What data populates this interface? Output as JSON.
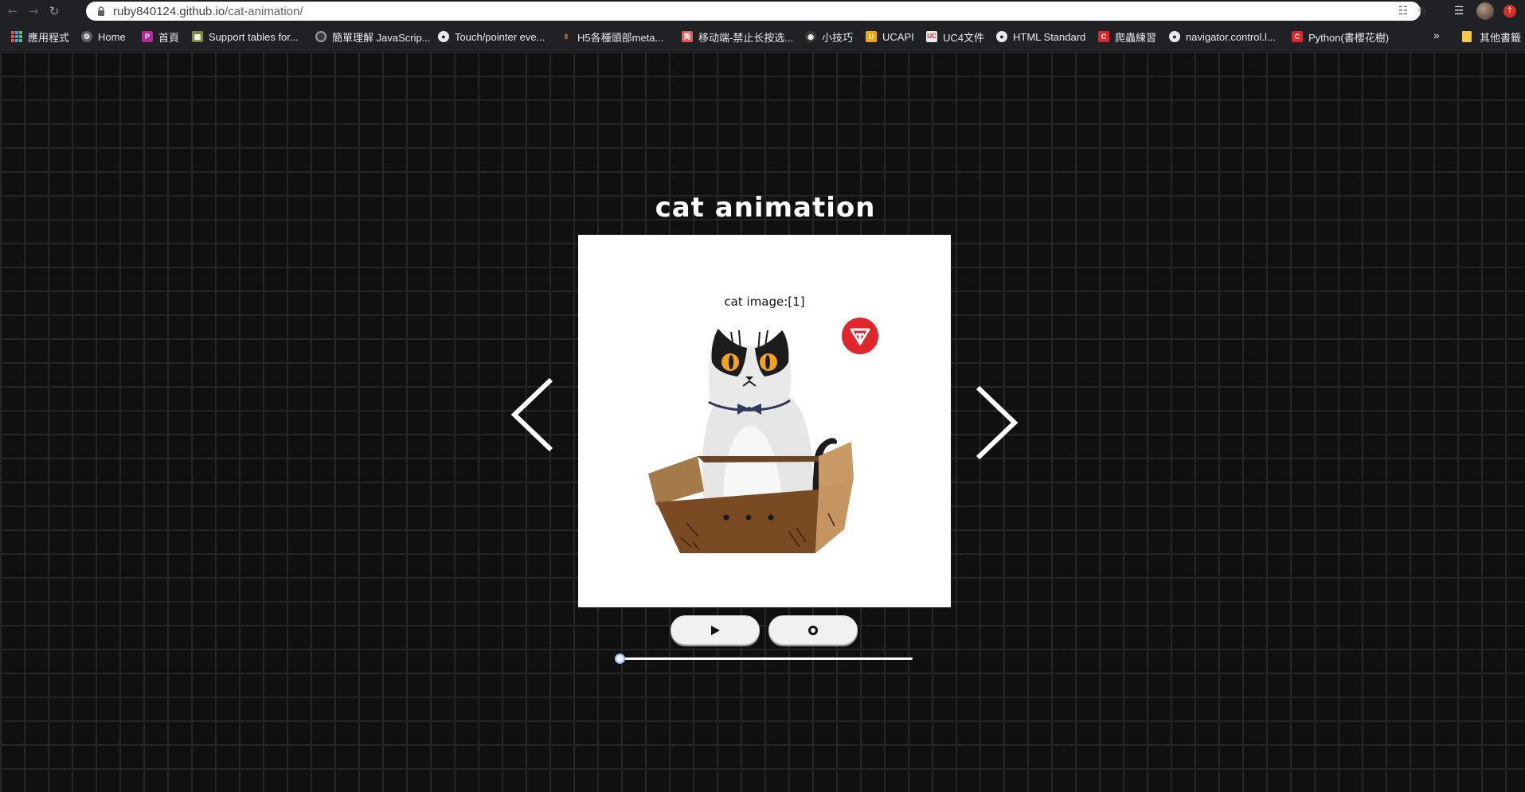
{
  "browser": {
    "url_host": "ruby840124.github.io",
    "url_path": "/cat-animation/",
    "bookmarks": [
      {
        "label": "應用程式",
        "icon": "apps-grid-icon"
      },
      {
        "label": "Home",
        "icon": "gear-icon"
      },
      {
        "label": "首頁",
        "icon": "p-icon"
      },
      {
        "label": "Support tables for...",
        "icon": "caniuse-icon"
      },
      {
        "label": "簡單理解 JavaScrip...",
        "icon": "circle-icon"
      },
      {
        "label": "Touch/pointer eve...",
        "icon": "globe-icon"
      },
      {
        "label": "H5各種頭部meta...",
        "icon": "bars-icon"
      },
      {
        "label": "移动端-禁止长按选...",
        "icon": "jian-icon"
      },
      {
        "label": "小技巧",
        "icon": "github-icon"
      },
      {
        "label": "UCAPI",
        "icon": "uc-icon"
      },
      {
        "label": "UC4文件",
        "icon": "uc-icon"
      },
      {
        "label": "HTML Standard",
        "icon": "globe-icon"
      },
      {
        "label": "爬蟲練習",
        "icon": "c-icon"
      },
      {
        "label": "navigator.control.l...",
        "icon": "globe-icon"
      },
      {
        "label": "Python(書櫻花樹)",
        "icon": "c-icon"
      }
    ],
    "more_label": "»",
    "other_bookmarks": "其他書籤"
  },
  "page": {
    "title": "cat animation",
    "caption": "cat image:[1]",
    "slider_progress": 0
  },
  "colors": {
    "background": "#101010",
    "badge": "#e0262d",
    "stage": "#ffffff"
  }
}
